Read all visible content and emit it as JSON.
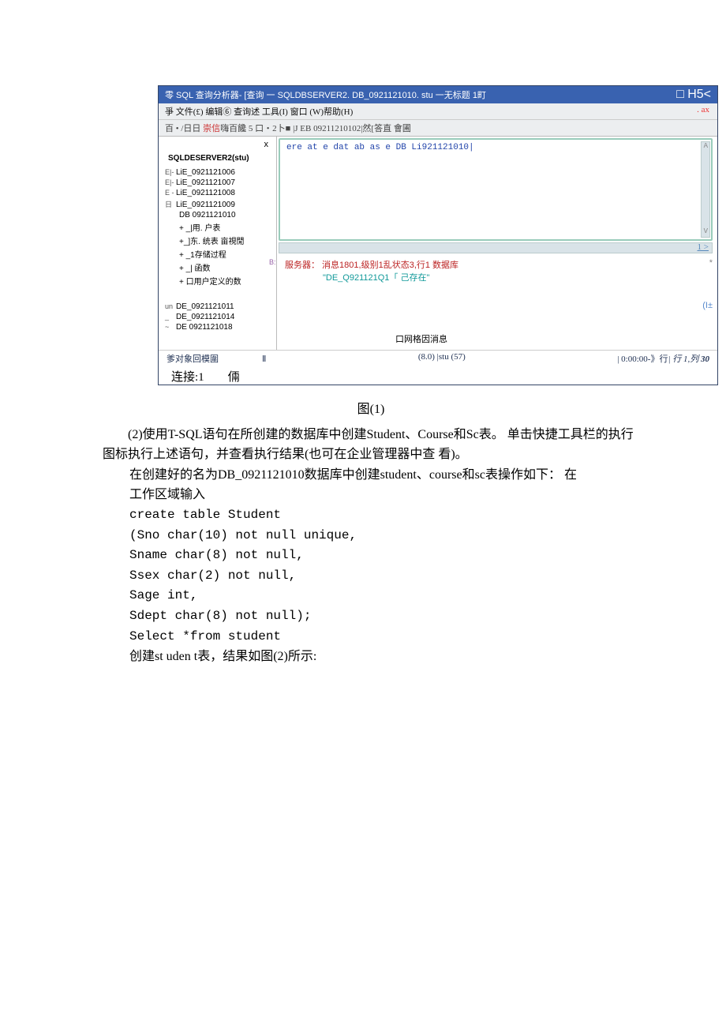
{
  "window": {
    "title_prefix": "零 SQL 查询分析器- [查询 一 SQLDBSERVER2. DB_0921121010. stu 一无标题 1町",
    "title_right": "□ H5<",
    "menu": "爭 文件(£) 编辑⑥ 查询述 工具(I) 窗口 (W)帮助(H)",
    "menu_corner": ". ax",
    "toolbar_left": "百 • /日日 ",
    "toolbar_red": "崇信",
    "toolbar_mid": "嗨百饞 5 口・2卜■ ",
    "toolbar_box": "|J EB 09211210102|",
    "toolbar_after": "然[答直 會圃"
  },
  "sidebar": {
    "close": "x",
    "server": "SQLDESERVER2(stu)",
    "dbs": [
      "LiE_0921121006",
      "LiE_0921121007",
      "LiE_0921121008",
      "LiE_0921121009",
      "DB 0921121010"
    ],
    "folders": [
      "+ _|用. 户表",
      "+_]东. 统表  亩視閒",
      "+ _1存储过程",
      "+ _| 函数",
      "+ 口用户定义的数"
    ],
    "lower": [
      "DE_0921121011",
      "DE_0921121014",
      "DE 0921121018"
    ]
  },
  "editor": {
    "text": "ere at e dat ab as e DB Li921121010|"
  },
  "scroll_end": "1 >",
  "msg": {
    "b": "B:",
    "line1": "服务器： 消息1801,级别1乱状态3,行1 数据库",
    "line2": "\"DE_Q921121Q1「 己存在\"",
    "iplus": "(I±",
    "star": "*"
  },
  "tabs": {
    "label": "口网格因消息"
  },
  "status": {
    "left": "爹对象回模圍",
    "mid_mark": "Ⅱ",
    "center": "(8.0) |stu (57)",
    "right_time": "| 0:00:00-》行",
    "right_mid": "|  行 1,列",
    "right_num": "30"
  },
  "below": "连接:1　　倆",
  "doc": {
    "fig1": "图(1)",
    "p1": "(2)使用T-SQL语句在所创建的数据库中创建Student、Course和Sc表。 单击快捷工具栏的执行图标执行上述语句，并查看执行结果(也可在企业管理器中查 看)。",
    "p2": "在创建好的名为DB_0921121010数据库中创建student、course和sc表操作如下：  在",
    "p3": "工作区域输入",
    "c1": "create table Student",
    "c2": "(Sno char(10) not null unique,",
    "c3": "Sname char(8) not null,",
    "c4": "Ssex char(2) not null,",
    "c5": "Sage int,",
    "c6": "Sdept char(8) not null);",
    "c7": "Select *from student",
    "p4": "创建st uden t表，结果如图(2)所示:"
  }
}
